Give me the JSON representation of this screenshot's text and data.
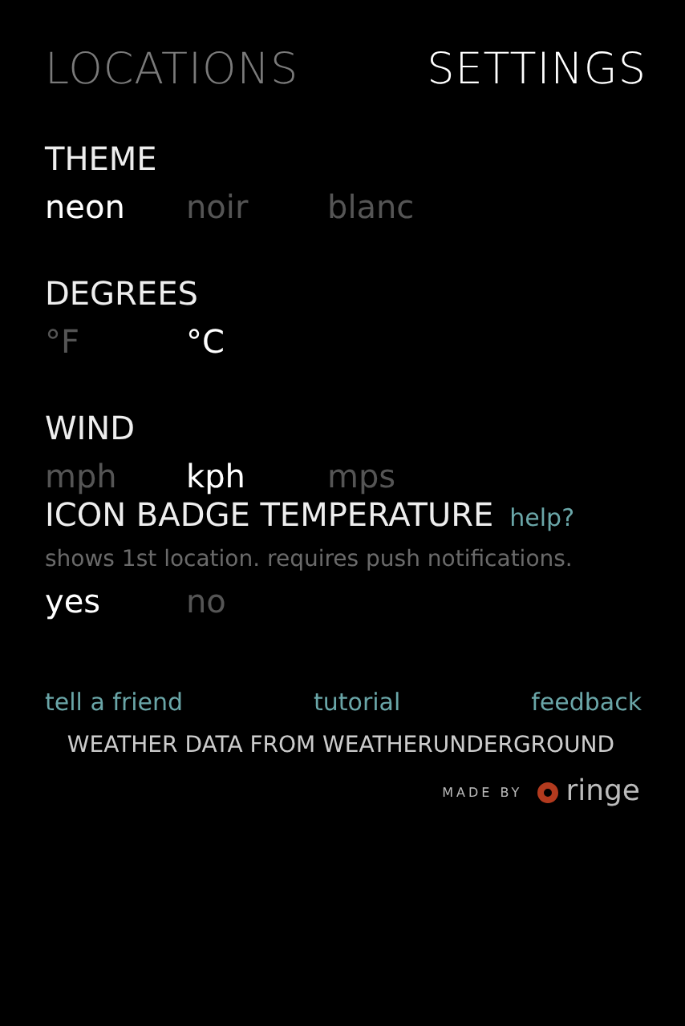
{
  "tabs": [
    {
      "label": "LOCATIONS",
      "selected": false
    },
    {
      "label": "SETTINGS",
      "selected": true
    }
  ],
  "sections": [
    {
      "title": "THEME",
      "options": [
        {
          "label": "neon",
          "selected": true
        },
        {
          "label": "noir",
          "selected": false
        },
        {
          "label": "blanc",
          "selected": false
        }
      ]
    },
    {
      "title": "DEGREES",
      "options": [
        {
          "label": "°F",
          "selected": false
        },
        {
          "label": "°C",
          "selected": true
        }
      ]
    },
    {
      "title": "WIND",
      "options": [
        {
          "label": "mph",
          "selected": false
        },
        {
          "label": "kph",
          "selected": true
        },
        {
          "label": "mps",
          "selected": false
        }
      ]
    },
    {
      "title": "ICON BADGE TEMPERATURE",
      "help": "help?",
      "description": "shows 1st location. requires push notifications.",
      "options": [
        {
          "label": "yes",
          "selected": true
        },
        {
          "label": "no",
          "selected": false
        }
      ]
    }
  ],
  "links": [
    "tell a friend",
    "tutorial",
    "feedback"
  ],
  "credit": "WEATHER DATA FROM WEATHERUNDERGROUND",
  "made_by": {
    "label": "MADE BY",
    "brand": "ringe"
  }
}
